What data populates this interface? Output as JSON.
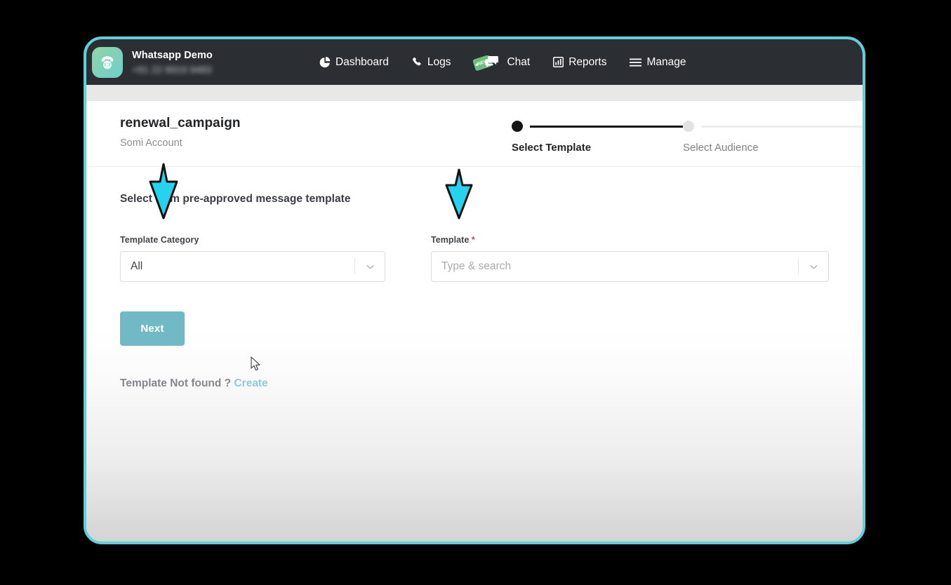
{
  "window": {
    "border_color": "#5ed0da",
    "page_background": "#000000"
  },
  "topbar": {
    "background": "#2b2f33",
    "brand": {
      "logo_icon": "rotary-phone-icon",
      "name": "Whatsapp Demo",
      "phone": "+91 22 6919 9483",
      "phone_blurred": true
    },
    "nav_items": [
      {
        "id": "dashboard",
        "label": "Dashboard",
        "icon": "pie-chart-icon",
        "badge": null
      },
      {
        "id": "logs",
        "label": "Logs",
        "icon": "phone-icon",
        "badge": null
      },
      {
        "id": "chat",
        "label": "Chat",
        "icon": "comments-icon",
        "badge": "NEW"
      },
      {
        "id": "reports",
        "label": "Reports",
        "icon": "bar-chart-icon",
        "badge": null
      },
      {
        "id": "manage",
        "label": "Manage",
        "icon": "hamburger-icon",
        "badge": null
      }
    ]
  },
  "campaign": {
    "title": "renewal_campaign",
    "subtitle": "Somi Account"
  },
  "stepper": {
    "steps": [
      {
        "id": "select-template",
        "label": "Select Template",
        "state": "active"
      },
      {
        "id": "select-audience",
        "label": "Select Audience",
        "state": "inactive"
      }
    ],
    "active_color": "#141414",
    "inactive_color": "#e2e2e2"
  },
  "form": {
    "heading": "Select from pre-approved message template",
    "category_field": {
      "label": "Template Category",
      "value": "All",
      "required": false,
      "chevron": "chevron-down-icon"
    },
    "template_field": {
      "label": "Template",
      "required_marker": "*",
      "value": "",
      "placeholder": "Type & search",
      "chevron": "chevron-down-icon"
    },
    "next_label": "Next",
    "next_color": "#72b9c6",
    "footer_text": "Template Not found ?",
    "footer_link": "Create",
    "footer_link_color": "#8fcbd9"
  },
  "annotations": {
    "arrow_color": "#25d3ef",
    "arrows": [
      {
        "id": "arrow-template-category",
        "points_to": "Template Category"
      },
      {
        "id": "arrow-template",
        "points_to": "Template"
      }
    ],
    "cursor": {
      "type": "arrow-pointer",
      "over": "Create"
    }
  }
}
